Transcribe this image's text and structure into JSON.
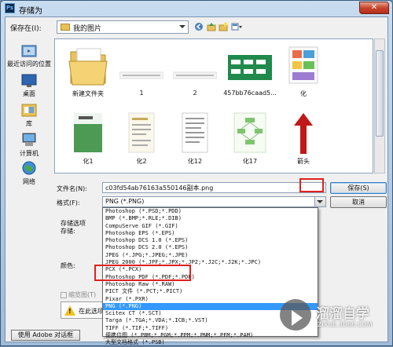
{
  "window": {
    "title": "存储为",
    "app_icon": "Ps",
    "close_label": "✕"
  },
  "toolbar": {
    "save_in_label": "保存在(I):",
    "location": "我的图片"
  },
  "places": [
    {
      "label": "最近访问的位置",
      "icon": "recent-places-icon"
    },
    {
      "label": "桌面",
      "icon": "desktop-icon"
    },
    {
      "label": "库",
      "icon": "library-icon"
    },
    {
      "label": "计算机",
      "icon": "computer-icon"
    },
    {
      "label": "网络",
      "icon": "network-icon"
    }
  ],
  "files": [
    {
      "name": "新建文件夹",
      "kind": "folder"
    },
    {
      "name": "1",
      "kind": "image"
    },
    {
      "name": "2",
      "kind": "image"
    },
    {
      "name": "457bb76caad5...",
      "kind": "image"
    },
    {
      "name": "化",
      "kind": "image"
    },
    {
      "name": "化1",
      "kind": "image"
    },
    {
      "name": "化2",
      "kind": "image"
    },
    {
      "name": "化12",
      "kind": "image"
    },
    {
      "name": "化17",
      "kind": "image"
    },
    {
      "name": "箭头",
      "kind": "image"
    }
  ],
  "form": {
    "filename_label": "文件名(N):",
    "filename_value": "c03fd54ab76163a550146副本.png",
    "format_label": "格式(F):",
    "format_value": "PNG (*.PNG)",
    "save_options_label": "存储选项",
    "store_label": "存储:",
    "color_label": "颜色:",
    "thumbnail_label": "缩览图(T)",
    "warning_text": "在此选项"
  },
  "buttons": {
    "save": "保存(S)",
    "cancel": "取消",
    "adobe_dialog": "使用 Adobe 对话框"
  },
  "format_options": [
    "Photoshop (*.PSD;*.PDD)",
    "BMP (*.BMP;*.RLE;*.DIB)",
    "CompuServe GIF (*.GIF)",
    "Photoshop EPS (*.EPS)",
    "Photoshop DCS 1.0 (*.EPS)",
    "Photoshop DCS 2.0 (*.EPS)",
    "JPEG (*.JPG;*.JPEG;*.JPE)",
    "JPEG 2000 (*.JPF;*.JPX;*.JP2;*.J2C;*.J2K;*.JPC)",
    "PCX (*.PCX)",
    "Photoshop PDF (*.PDF;*.PDP)",
    "Photoshop Raw (*.RAW)",
    "PICT 文件 (*.PCT;*.PICT)",
    "Pixar (*.PXR)",
    "PNG (*.PNG)",
    "Scitex CT (*.SCT)",
    "Targa (*.TGA;*.VDA;*.ICB;*.VST)",
    "TIFF (*.TIF;*.TIFF)",
    "便携位图 (*.PBM;*.PGM;*.PPM;*.PNM;*.PFM;*.PAM)",
    "大型文档格式 (*.PSB)"
  ],
  "selected_format_index": 13,
  "watermark": {
    "brand": "溜溜自学",
    "url": "ZIXUE.3D66.COM"
  },
  "colors": {
    "highlight": "#3399ff",
    "annotation": "#e02020"
  }
}
